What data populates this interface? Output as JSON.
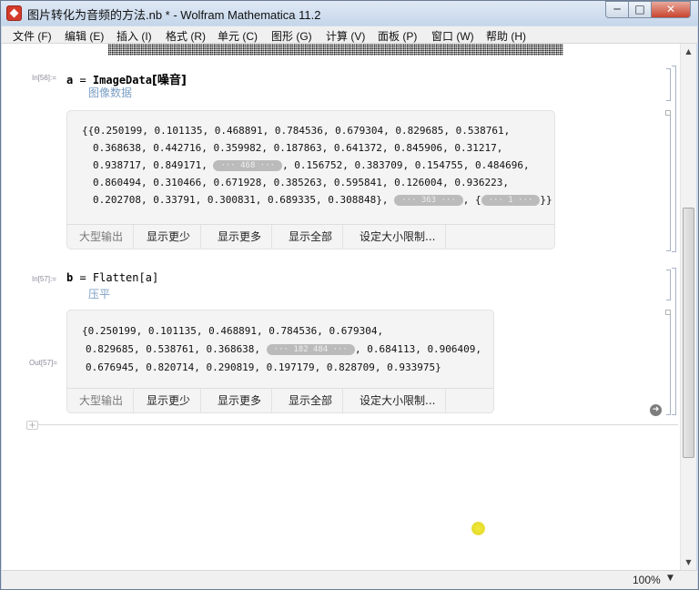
{
  "window": {
    "title": "图片转化为音频的方法.nb * - Wolfram Mathematica 11.2",
    "minimize": "─",
    "maximize": "□",
    "close": "✕"
  },
  "menu": [
    "文件 (F)",
    "编辑 (E)",
    "插入 (I)",
    "格式 (R)",
    "单元 (C)",
    "图形 (G)",
    "计算 (V)",
    "面板 (P)",
    "窗口 (W)",
    "帮助 (H)"
  ],
  "cell1": {
    "label": "In[56]:=",
    "code_var": "a",
    "code_eq": " = ",
    "code_fn": "ImageData",
    "code_arg": "[噪音]",
    "hint": "图像数据",
    "output_lines": [
      "{{0.250199, 0.101135, 0.468891, 0.784536, 0.679304, 0.829685, 0.538761,",
      "0.368638, 0.442716, 0.359982, 0.187863, 0.641372, 0.845906, 0.31217,",
      "0.938717, 0.849171, ",
      ", 0.156752, 0.383709, 0.154755, 0.484696,",
      "0.860494, 0.310466, 0.671928, 0.385263, 0.595841, 0.126004, 0.936223,",
      "0.202708, 0.33791, 0.300831, 0.689335, 0.308848}, ",
      ", {",
      "}}"
    ],
    "skeleton_1": "··· 468 ···",
    "skeleton_2": "··· 363 ···",
    "skeleton_3": "··· 1 ···"
  },
  "cell2": {
    "in_label": "In[57]:=",
    "out_label": "Out[57]=",
    "code_var": "b",
    "code_eq": " = ",
    "code_fn": "Flatten",
    "code_arg": "[a]",
    "hint": "压平",
    "output_lines": [
      "{0.250199, 0.101135, 0.468891, 0.784536, 0.679304,",
      "0.829685, 0.538761, 0.368638, ",
      ", 0.684113, 0.906409,",
      "0.676945, 0.820714, 0.290819, 0.197179, 0.828709, 0.933975}"
    ],
    "skeleton": "··· 182 484 ···"
  },
  "toolbar": {
    "large_output": "大型输出",
    "show_less": "显示更少",
    "show_more": "显示更多",
    "show_all": "显示全部",
    "set_limit": "设定大小限制..."
  },
  "status": {
    "zoom": "100%",
    "zoom_arrow": "▼"
  },
  "scroll": {
    "up": "▲",
    "down": "▼"
  },
  "misc": {
    "plus": "+",
    "arrow": "➜"
  }
}
